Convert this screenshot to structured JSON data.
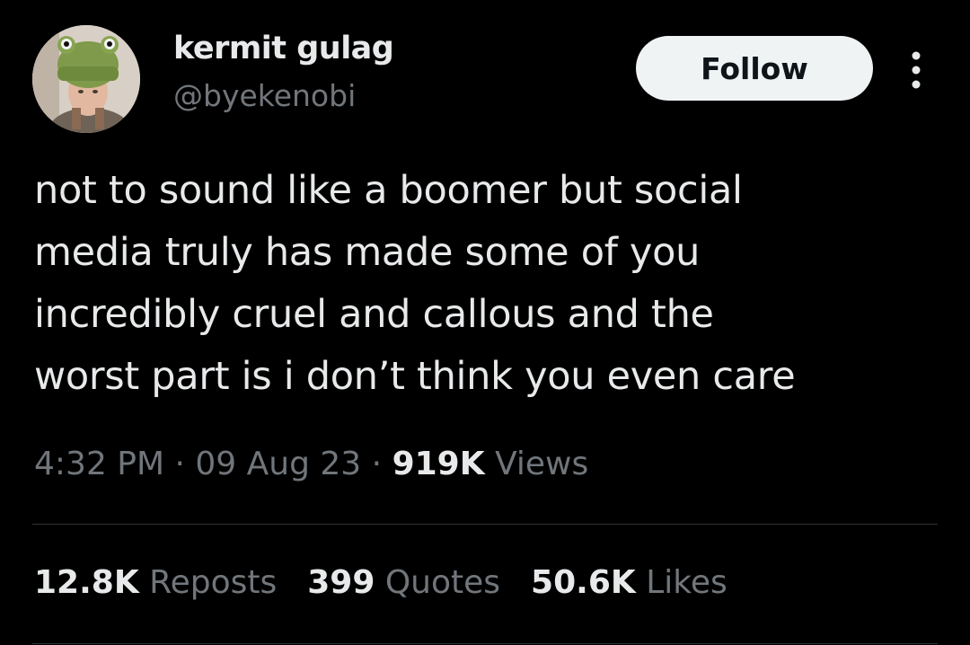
{
  "author": {
    "display_name": "kermit gulag",
    "handle": "@byekenobi",
    "avatar_icon": "profile-photo-frog-hat"
  },
  "follow_button": {
    "label": "Follow"
  },
  "more_menu": {
    "icon": "more-vertical-icon"
  },
  "tweet": {
    "text_lines": [
      "not to sound like a boomer but social",
      "media truly has made some of you",
      "incredibly cruel and callous and the",
      "worst part is i don’t think you even care"
    ]
  },
  "meta": {
    "time": "4:32 PM",
    "separator": " · ",
    "date": "09 Aug 23",
    "views_count": "919K",
    "views_label": "Views"
  },
  "stats": {
    "reposts_count": "12.8K",
    "reposts_label": "Reposts",
    "quotes_count": "399",
    "quotes_label": "Quotes",
    "likes_count": "50.6K",
    "likes_label": "Likes"
  },
  "colors": {
    "background": "#000000",
    "primary_text": "#e7e9ea",
    "secondary_text": "#71767b",
    "button_background": "#eff3f4",
    "button_text": "#0f1419",
    "divider": "#2f3336"
  }
}
